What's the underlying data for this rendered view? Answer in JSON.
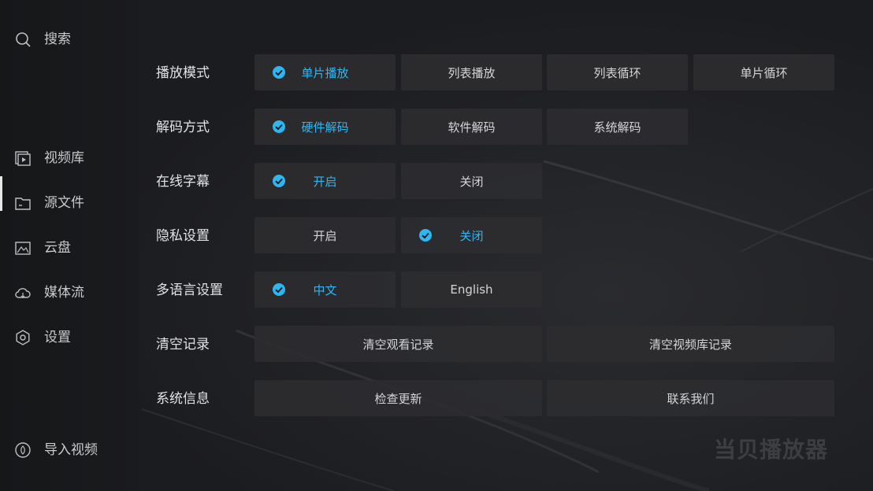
{
  "sidebar": {
    "items": [
      {
        "label": "搜索",
        "icon": "search-icon"
      },
      {
        "label": "视频库",
        "icon": "video-library-icon"
      },
      {
        "label": "源文件",
        "icon": "folder-icon"
      },
      {
        "label": "云盘",
        "icon": "cloud-drive-icon"
      },
      {
        "label": "媒体流",
        "icon": "cloud-stream-icon"
      },
      {
        "label": "设置",
        "icon": "gear-icon"
      },
      {
        "label": "导入视频",
        "icon": "import-icon"
      }
    ],
    "active": "源文件"
  },
  "settings": {
    "play_mode": {
      "label": "播放模式",
      "options": [
        "单片播放",
        "列表播放",
        "列表循环",
        "单片循环"
      ],
      "selected": "单片播放"
    },
    "decode": {
      "label": "解码方式",
      "options": [
        "硬件解码",
        "软件解码",
        "系统解码"
      ],
      "selected": "硬件解码"
    },
    "subtitle": {
      "label": "在线字幕",
      "options": [
        "开启",
        "关闭"
      ],
      "selected": "开启"
    },
    "privacy": {
      "label": "隐私设置",
      "options": [
        "开启",
        "关闭"
      ],
      "selected": "关闭"
    },
    "language": {
      "label": "多语言设置",
      "options": [
        "中文",
        "English"
      ],
      "selected": "中文"
    },
    "clear": {
      "label": "清空记录",
      "options": [
        "清空观看记录",
        "清空视频库记录"
      ]
    },
    "system": {
      "label": "系统信息",
      "options": [
        "检查更新",
        "联系我们"
      ]
    }
  },
  "brand": "当贝播放器",
  "colors": {
    "accent": "#2fb6f0",
    "background": "#1b1c1f",
    "button": "#2c2d30"
  }
}
